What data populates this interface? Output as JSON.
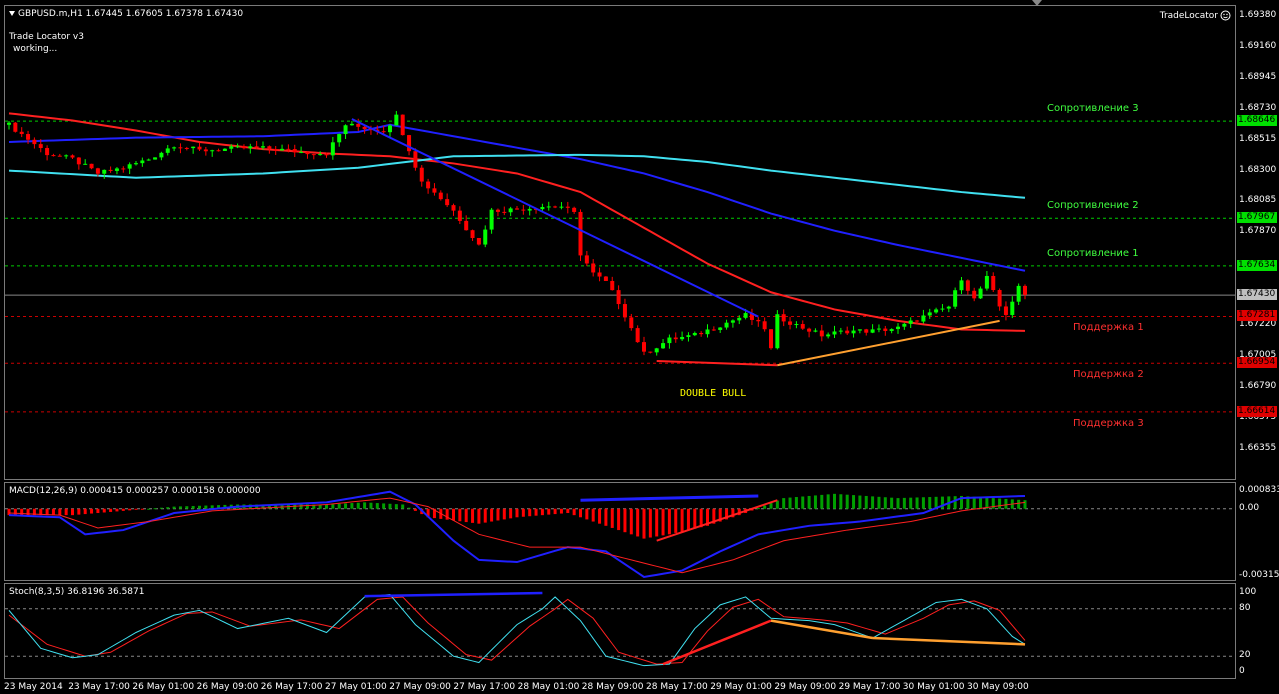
{
  "header": {
    "symbol_ohlc": "GBPUSD.m,H1  1.67445 1.67605 1.67378 1.67430",
    "indicator_name": "Trade Locator v3",
    "indicator_status": "working...",
    "trade_locator_label": "TradeLocator"
  },
  "colors": {
    "bull": "#00ff00",
    "bear": "#ff0000",
    "ma_red": "#ff2020",
    "ma_blue": "#2020ff",
    "ma_cyan": "#40e0f0",
    "resistance": "#00cc00",
    "support": "#cc0000",
    "trend_orange": "#ffa030"
  },
  "levels": [
    {
      "label": "Сопротивление 3",
      "price": 1.68646,
      "tag": "1.68646",
      "kind": "resistance"
    },
    {
      "label": "Сопротивление 2",
      "price": 1.67967,
      "tag": "1.67967",
      "kind": "resistance"
    },
    {
      "label": "Сопротивление 1",
      "price": 1.67634,
      "tag": "1.67634",
      "kind": "resistance"
    },
    {
      "label": "Поддержка 1",
      "price": 1.67281,
      "tag": "1.67281",
      "kind": "support"
    },
    {
      "label": "Поддержка 2",
      "price": 1.66954,
      "tag": "1.66954",
      "kind": "support"
    },
    {
      "label": "Поддержка 3",
      "price": 1.66614,
      "tag": "1.66614",
      "kind": "support"
    }
  ],
  "current_price": {
    "price": 1.6743,
    "tag": "1.67430"
  },
  "price_axis": {
    "range": [
      1.66355,
      1.6938
    ],
    "ticks": [
      "1.69380",
      "1.69160",
      "1.68945",
      "1.68730",
      "1.68515",
      "1.68300",
      "1.68085",
      "1.67870",
      "1.67220",
      "1.67005",
      "1.66790",
      "1.66575",
      "1.66355"
    ]
  },
  "annotation": {
    "text": "DOUBLE BULL",
    "color": "#ffff00"
  },
  "macd": {
    "title": "MACD(12,26,9) 0.000415 0.000257 0.000158 0.000000",
    "axis_ticks": [
      "0.000833",
      "0.00",
      "-0.003155"
    ],
    "range": [
      -0.003155,
      0.000833
    ]
  },
  "stoch": {
    "title": "Stoch(8,3,5) 36.8196 36.5871",
    "axis_ticks": [
      "100",
      "80",
      "20",
      "0"
    ],
    "range": [
      0,
      100
    ]
  },
  "time_axis": {
    "labels": [
      "23 May 2014",
      "23 May 17:00",
      "26 May 01:00",
      "26 May 09:00",
      "26 May 17:00",
      "27 May 01:00",
      "27 May 09:00",
      "27 May 17:00",
      "28 May 01:00",
      "28 May 09:00",
      "28 May 17:00",
      "29 May 01:00",
      "29 May 09:00",
      "29 May 17:00",
      "30 May 01:00",
      "30 May 09:00"
    ]
  },
  "chart_data": {
    "type": "candlestick",
    "symbol": "GBPUSD.m",
    "timeframe": "H1",
    "ylim": [
      1.66355,
      1.6938
    ],
    "close_anchors": [
      [
        0,
        1.6862
      ],
      [
        6,
        1.6842
      ],
      [
        10,
        1.6838
      ],
      [
        14,
        1.6828
      ],
      [
        18,
        1.6832
      ],
      [
        22,
        1.6838
      ],
      [
        26,
        1.6848
      ],
      [
        30,
        1.6844
      ],
      [
        34,
        1.6845
      ],
      [
        38,
        1.6846
      ],
      [
        42,
        1.6845
      ],
      [
        46,
        1.6843
      ],
      [
        50,
        1.6842
      ],
      [
        53,
        1.6862
      ],
      [
        56,
        1.686
      ],
      [
        59,
        1.6858
      ],
      [
        61,
        1.6868
      ],
      [
        63,
        1.6845
      ],
      [
        65,
        1.6822
      ],
      [
        67,
        1.6815
      ],
      [
        70,
        1.6802
      ],
      [
        72,
        1.679
      ],
      [
        74,
        1.6778
      ],
      [
        76,
        1.6802
      ],
      [
        80,
        1.6803
      ],
      [
        84,
        1.6805
      ],
      [
        87,
        1.6805
      ],
      [
        89,
        1.68
      ],
      [
        90,
        1.6772
      ],
      [
        92,
        1.6758
      ],
      [
        94,
        1.6752
      ],
      [
        96,
        1.6738
      ],
      [
        98,
        1.672
      ],
      [
        100,
        1.6702
      ],
      [
        104,
        1.6712
      ],
      [
        108,
        1.6715
      ],
      [
        112,
        1.6722
      ],
      [
        116,
        1.6729
      ],
      [
        119,
        1.672
      ],
      [
        120,
        1.6705
      ],
      [
        121,
        1.6728
      ],
      [
        124,
        1.6722
      ],
      [
        128,
        1.6715
      ],
      [
        132,
        1.6718
      ],
      [
        136,
        1.6718
      ],
      [
        140,
        1.672
      ],
      [
        144,
        1.6728
      ],
      [
        148,
        1.6735
      ],
      [
        150,
        1.6755
      ],
      [
        152,
        1.674
      ],
      [
        154,
        1.6755
      ],
      [
        156,
        1.6735
      ],
      [
        157,
        1.673
      ],
      [
        159,
        1.6748
      ],
      [
        160,
        1.6743
      ]
    ],
    "moving_averages": [
      {
        "color": "red",
        "points": [
          [
            0,
            1.687
          ],
          [
            10,
            1.6865
          ],
          [
            20,
            1.6858
          ],
          [
            30,
            1.685
          ],
          [
            40,
            1.6845
          ],
          [
            50,
            1.6842
          ],
          [
            60,
            1.684
          ],
          [
            70,
            1.6835
          ],
          [
            80,
            1.6828
          ],
          [
            90,
            1.6815
          ],
          [
            100,
            1.679
          ],
          [
            110,
            1.6765
          ],
          [
            120,
            1.6745
          ],
          [
            130,
            1.6733
          ],
          [
            140,
            1.6725
          ],
          [
            150,
            1.6719
          ],
          [
            160,
            1.6718
          ]
        ]
      },
      {
        "color": "blue",
        "points": [
          [
            0,
            1.685
          ],
          [
            20,
            1.6853
          ],
          [
            40,
            1.6854
          ],
          [
            55,
            1.6857
          ],
          [
            60,
            1.6862
          ],
          [
            70,
            1.6854
          ],
          [
            80,
            1.6846
          ],
          [
            90,
            1.6838
          ],
          [
            100,
            1.6828
          ],
          [
            110,
            1.6815
          ],
          [
            120,
            1.68
          ],
          [
            130,
            1.6788
          ],
          [
            140,
            1.6778
          ],
          [
            150,
            1.6769
          ],
          [
            160,
            1.676
          ]
        ]
      },
      {
        "color": "cyan",
        "points": [
          [
            0,
            1.683
          ],
          [
            20,
            1.6825
          ],
          [
            40,
            1.6828
          ],
          [
            55,
            1.6832
          ],
          [
            70,
            1.684
          ],
          [
            90,
            1.6841
          ],
          [
            100,
            1.684
          ],
          [
            110,
            1.6836
          ],
          [
            120,
            1.683
          ],
          [
            130,
            1.6825
          ],
          [
            140,
            1.682
          ],
          [
            150,
            1.6815
          ],
          [
            160,
            1.6811
          ]
        ]
      }
    ],
    "trend_lines": [
      {
        "color": "blue",
        "from": [
          54,
          1.6866
        ],
        "to": [
          118,
          1.6728
        ]
      },
      {
        "color": "red",
        "from": [
          102,
          1.6697
        ],
        "to": [
          121,
          1.6694
        ]
      },
      {
        "color": "orange",
        "from": [
          121,
          1.6694
        ],
        "to": [
          156,
          1.6725
        ]
      }
    ],
    "macd_histogram_anchors": [
      [
        0,
        -0.0003
      ],
      [
        10,
        -0.0003
      ],
      [
        18,
        -0.0001
      ],
      [
        26,
        0.0001
      ],
      [
        36,
        0.0002
      ],
      [
        50,
        0.0002
      ],
      [
        56,
        0.0003
      ],
      [
        62,
        0.0002
      ],
      [
        66,
        -0.0004
      ],
      [
        74,
        -0.0007
      ],
      [
        80,
        -0.0004
      ],
      [
        88,
        -0.0002
      ],
      [
        94,
        -0.0008
      ],
      [
        100,
        -0.0014
      ],
      [
        104,
        -0.0012
      ],
      [
        110,
        -0.0008
      ],
      [
        116,
        -0.0002
      ],
      [
        122,
        0.0005
      ],
      [
        130,
        0.0007
      ],
      [
        140,
        0.0005
      ],
      [
        150,
        0.0006
      ],
      [
        160,
        0.0004
      ]
    ],
    "macd_line_anchors": [
      [
        0,
        -0.0003
      ],
      [
        8,
        -0.0004
      ],
      [
        12,
        -0.0012
      ],
      [
        18,
        -0.001
      ],
      [
        26,
        -0.0002
      ],
      [
        36,
        0.0001
      ],
      [
        50,
        0.0003
      ],
      [
        60,
        0.0008
      ],
      [
        64,
        0.0002
      ],
      [
        70,
        -0.0015
      ],
      [
        74,
        -0.0024
      ],
      [
        80,
        -0.0025
      ],
      [
        88,
        -0.0018
      ],
      [
        94,
        -0.002
      ],
      [
        100,
        -0.0032
      ],
      [
        106,
        -0.0029
      ],
      [
        112,
        -0.002
      ],
      [
        118,
        -0.0012
      ],
      [
        126,
        -0.0008
      ],
      [
        134,
        -0.0006
      ],
      [
        144,
        -0.0002
      ],
      [
        150,
        0.0005
      ],
      [
        160,
        0.0006
      ]
    ],
    "macd_signal_anchors": [
      [
        0,
        -0.0002
      ],
      [
        8,
        -0.0003
      ],
      [
        14,
        -0.0009
      ],
      [
        22,
        -0.0006
      ],
      [
        32,
        -0.0001
      ],
      [
        50,
        0.0002
      ],
      [
        60,
        0.0005
      ],
      [
        66,
        0.0001
      ],
      [
        74,
        -0.0012
      ],
      [
        82,
        -0.0018
      ],
      [
        90,
        -0.0018
      ],
      [
        98,
        -0.0024
      ],
      [
        106,
        -0.003
      ],
      [
        114,
        -0.0024
      ],
      [
        122,
        -0.0015
      ],
      [
        132,
        -0.001
      ],
      [
        142,
        -0.0006
      ],
      [
        150,
        -0.0001
      ],
      [
        160,
        0.0003
      ]
    ],
    "stoch_k_anchors": [
      [
        0,
        78
      ],
      [
        5,
        30
      ],
      [
        10,
        18
      ],
      [
        14,
        22
      ],
      [
        20,
        50
      ],
      [
        26,
        72
      ],
      [
        30,
        78
      ],
      [
        36,
        55
      ],
      [
        44,
        68
      ],
      [
        50,
        50
      ],
      [
        56,
        95
      ],
      [
        60,
        98
      ],
      [
        64,
        60
      ],
      [
        70,
        20
      ],
      [
        74,
        12
      ],
      [
        80,
        60
      ],
      [
        84,
        80
      ],
      [
        86,
        95
      ],
      [
        90,
        65
      ],
      [
        94,
        20
      ],
      [
        100,
        8
      ],
      [
        104,
        10
      ],
      [
        108,
        55
      ],
      [
        112,
        85
      ],
      [
        116,
        95
      ],
      [
        120,
        68
      ],
      [
        126,
        65
      ],
      [
        130,
        60
      ],
      [
        136,
        43
      ],
      [
        142,
        70
      ],
      [
        146,
        88
      ],
      [
        150,
        92
      ],
      [
        154,
        80
      ],
      [
        158,
        45
      ],
      [
        160,
        35
      ]
    ],
    "stoch_d_anchors": [
      [
        0,
        72
      ],
      [
        6,
        35
      ],
      [
        12,
        20
      ],
      [
        16,
        25
      ],
      [
        22,
        52
      ],
      [
        28,
        74
      ],
      [
        32,
        76
      ],
      [
        38,
        58
      ],
      [
        46,
        66
      ],
      [
        52,
        55
      ],
      [
        58,
        92
      ],
      [
        62,
        95
      ],
      [
        66,
        62
      ],
      [
        72,
        22
      ],
      [
        76,
        15
      ],
      [
        82,
        58
      ],
      [
        86,
        80
      ],
      [
        88,
        92
      ],
      [
        92,
        68
      ],
      [
        96,
        25
      ],
      [
        102,
        10
      ],
      [
        106,
        12
      ],
      [
        110,
        52
      ],
      [
        114,
        82
      ],
      [
        118,
        92
      ],
      [
        122,
        70
      ],
      [
        128,
        66
      ],
      [
        132,
        62
      ],
      [
        138,
        48
      ],
      [
        144,
        68
      ],
      [
        148,
        85
      ],
      [
        152,
        90
      ],
      [
        156,
        78
      ],
      [
        160,
        40
      ]
    ],
    "stoch_lines": [
      {
        "color": "blue",
        "from": [
          56,
          96
        ],
        "to": [
          84,
          100
        ]
      },
      {
        "color": "red",
        "from": [
          103,
          10
        ],
        "to": [
          120,
          65
        ]
      },
      {
        "color": "orange",
        "from": [
          120,
          65
        ],
        "to": [
          136,
          43
        ]
      },
      {
        "color": "orange",
        "from": [
          136,
          43
        ],
        "to": [
          160,
          35
        ]
      }
    ]
  }
}
